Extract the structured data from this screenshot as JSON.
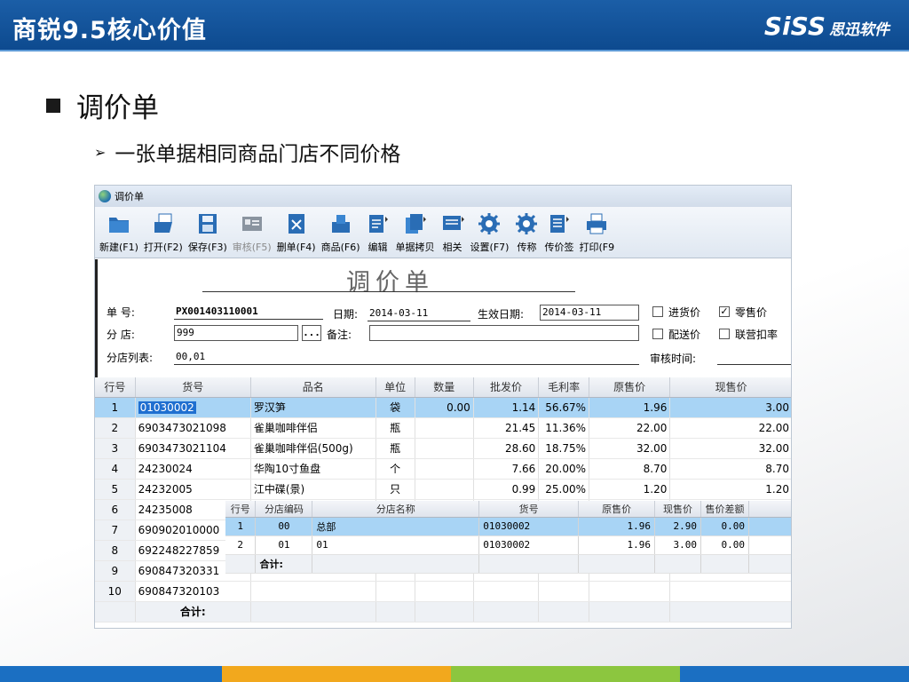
{
  "slide": {
    "header_title": "商锐9.5核心价值",
    "logo_brand": "SiSS",
    "logo_cn": "思迅软件",
    "bullet1": "调价单",
    "bullet2": "一张单据相同商品门店不同价格",
    "header_color": "#0d4a8f",
    "footer_colors": [
      "#1b6fc2",
      "#f2a81d",
      "#8cc63f",
      "#1b6fc2"
    ]
  },
  "window": {
    "title": "调价单",
    "toolbar": [
      {
        "label": "新建(F1)",
        "icon": "folder-new-icon"
      },
      {
        "label": "打开(F2)",
        "icon": "folder-open-icon"
      },
      {
        "label": "保存(F3)",
        "icon": "save-icon"
      },
      {
        "label": "审核(F5)",
        "icon": "approve-icon",
        "disabled": true
      },
      {
        "label": "删单(F4)",
        "icon": "delete-doc-icon"
      },
      {
        "label": "商品(F6)",
        "icon": "goods-icon"
      },
      {
        "label": "编辑",
        "icon": "edit-icon"
      },
      {
        "label": "单据拷贝",
        "icon": "copy-doc-icon"
      },
      {
        "label": "相关",
        "icon": "related-icon"
      },
      {
        "label": "设置(F7)",
        "icon": "settings-gear-icon"
      },
      {
        "label": "传称",
        "icon": "scale-gear-icon"
      },
      {
        "label": "传价签",
        "icon": "price-tag-icon"
      },
      {
        "label": "打印(F9",
        "icon": "printer-icon"
      }
    ]
  },
  "form": {
    "doc_title": "调价单",
    "order_no_label": "单    号:",
    "order_no": "PX001403110001",
    "date_label": "日期:",
    "date": "2014-03-11",
    "effective_label": "生效日期:",
    "effective_date": "2014-03-11",
    "branch_label": "分    店:",
    "branch": "999",
    "browse": "...",
    "note_label": "备注:",
    "note": "",
    "branch_list_label": "分店列表:",
    "branch_list": "00,01",
    "audit_time_label": "审核时间:",
    "audit_time": "",
    "checks": [
      {
        "label": "进货价",
        "checked": false
      },
      {
        "label": "零售价",
        "checked": true
      },
      {
        "label": "配送价",
        "checked": false
      },
      {
        "label": "联营扣率",
        "checked": false
      }
    ]
  },
  "grid": {
    "columns": [
      "行号",
      "货号",
      "品名",
      "单位",
      "数量",
      "批发价",
      "毛利率",
      "原售价",
      "现售价"
    ],
    "rows": [
      {
        "no": "1",
        "code": "01030002",
        "name": "罗汉笋",
        "unit": "袋",
        "qty": "0.00",
        "wholesale": "1.14",
        "margin": "56.67%",
        "orig": "1.96",
        "now": "3.00"
      },
      {
        "no": "2",
        "code": "6903473021098",
        "name": "雀巢咖啡伴侣",
        "unit": "瓶",
        "qty": "",
        "wholesale": "21.45",
        "margin": "11.36%",
        "orig": "22.00",
        "now": "22.00"
      },
      {
        "no": "3",
        "code": "6903473021104",
        "name": "雀巢咖啡伴侣(500g)",
        "unit": "瓶",
        "qty": "",
        "wholesale": "28.60",
        "margin": "18.75%",
        "orig": "32.00",
        "now": "32.00"
      },
      {
        "no": "4",
        "code": "24230024",
        "name": "华陶10寸鱼盘",
        "unit": "个",
        "qty": "",
        "wholesale": "7.66",
        "margin": "20.00%",
        "orig": "8.70",
        "now": "8.70"
      },
      {
        "no": "5",
        "code": "24232005",
        "name": "江中碟(景)",
        "unit": "只",
        "qty": "",
        "wholesale": "0.99",
        "margin": "25.00%",
        "orig": "1.20",
        "now": "1.20"
      },
      {
        "no": "6",
        "code": "24235008",
        "name": "",
        "unit": "",
        "qty": "",
        "wholesale": "",
        "margin": "",
        "orig": "",
        "now": ""
      },
      {
        "no": "7",
        "code": "690902010000",
        "name": "",
        "unit": "",
        "qty": "",
        "wholesale": "",
        "margin": "",
        "orig": "",
        "now": ""
      },
      {
        "no": "8",
        "code": "692248227859",
        "name": "",
        "unit": "",
        "qty": "",
        "wholesale": "",
        "margin": "",
        "orig": "",
        "now": ""
      },
      {
        "no": "9",
        "code": "690847320331",
        "name": "",
        "unit": "",
        "qty": "",
        "wholesale": "",
        "margin": "",
        "orig": "",
        "now": ""
      },
      {
        "no": "10",
        "code": "690847320103",
        "name": "",
        "unit": "",
        "qty": "",
        "wholesale": "",
        "margin": "",
        "orig": "",
        "now": ""
      }
    ],
    "total_label": "合计:"
  },
  "subgrid": {
    "columns": [
      "行号",
      "分店编码",
      "分店名称",
      "货号",
      "原售价",
      "现售价",
      "售价差额"
    ],
    "rows": [
      {
        "no": "1",
        "branch_code": "00",
        "branch_name": "总部",
        "code": "01030002",
        "orig": "1.96",
        "now": "2.90",
        "diff": "0.00"
      },
      {
        "no": "2",
        "branch_code": "01",
        "branch_name": "01",
        "code": "01030002",
        "orig": "1.96",
        "now": "3.00",
        "diff": "0.00"
      }
    ],
    "total_label": "合计:"
  }
}
